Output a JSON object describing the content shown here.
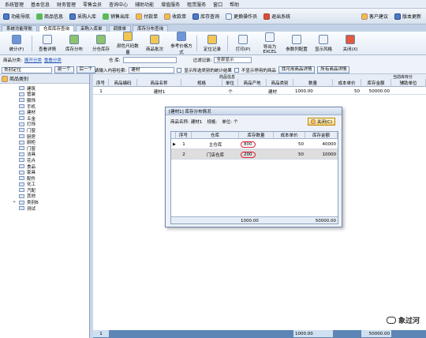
{
  "menubar": [
    "系统管理",
    "基本信息",
    "财务管理",
    "零售会员",
    "查询中心",
    "辅助功能",
    "增值服务",
    "租赁服务",
    "窗口",
    "帮助"
  ],
  "toolbar1": {
    "left": [
      "功能导航",
      "商品信息",
      "采购入库",
      "销售出库",
      "付款单",
      "收款单",
      "库存查询",
      "更换操作员",
      "退出系统"
    ],
    "right": [
      "客户建议",
      "版本更新"
    ]
  },
  "tabs": [
    "系统功能导航",
    "仓库库存查询",
    "采购入库单",
    "调拨单",
    "库存分布查询"
  ],
  "toolbar2": [
    "统计(F)",
    "查看详情",
    "库存分布",
    "分仓库存",
    "颜色尺码数量",
    "商品批次",
    "参考价格方式",
    "定位记录",
    "打印(P)",
    "导出为EXCEL",
    "参数列配置",
    "显示风格",
    "关闭(X)"
  ],
  "filters": {
    "category_label": "商品分类:",
    "category_all": "展开分类",
    "category_collapse": "重叠分类",
    "warehouse_label": "仓  库:",
    "warehouse_value": "",
    "filter_label": "过滤记录:",
    "filter_value": "全部显示",
    "search_label": "请输入内容检索:",
    "search_value": "建材",
    "chk1": "显示所选类别的统计结果",
    "chk2": "不显示停用的商品",
    "btn_find": "找可用商品详情",
    "btn_dist": "所有商品详情",
    "tree_search": "类别定位",
    "prev": "前一个",
    "next": "后一个"
  },
  "tree": {
    "root": "商品类别",
    "items": [
      "建筑",
      "管装",
      "服饰",
      "手机",
      "建材",
      "五金",
      "灯饰",
      "门窗",
      "厨房",
      "厨柜",
      "门窗",
      "洁具",
      "花卉",
      "食品",
      "家具",
      "配件",
      "化工",
      "汽配",
      "其他",
      "类别B",
      "测试"
    ]
  },
  "grid": {
    "group_header": "商品信息",
    "group_right": "当前库存分",
    "headers": [
      "序号",
      "商品编码",
      "商品名称",
      "规格",
      "单位",
      "商品产地",
      "商品类别",
      "数量",
      "成本单价",
      "库存金额",
      "辅助单位"
    ],
    "rows": [
      [
        "1",
        "",
        "建材1",
        "",
        "个",
        "",
        "建材",
        "1000.00",
        "50",
        "50000.00",
        ""
      ]
    ],
    "footer": {
      "row": "1",
      "qty": "1000.00",
      "amount": "50000.00"
    }
  },
  "dialog": {
    "title": "[建材1] 库存分布情况",
    "info_name_label": "商品名称:",
    "info_name": "建材1",
    "info_spec_label": "规格:",
    "info_unit_label": "单位:",
    "info_unit": "个",
    "close": "关闭(C)",
    "headers": [
      "序号",
      "仓库",
      "库存数量",
      "成本单价",
      "库存金额"
    ],
    "rows": [
      [
        "1",
        "主仓库",
        "800",
        "50",
        "40000"
      ],
      [
        "2",
        "门店仓库",
        "200",
        "50",
        "10000"
      ]
    ],
    "footer": {
      "qty": "1000.00",
      "amount": "50000.00"
    }
  },
  "watermark": "象过河"
}
